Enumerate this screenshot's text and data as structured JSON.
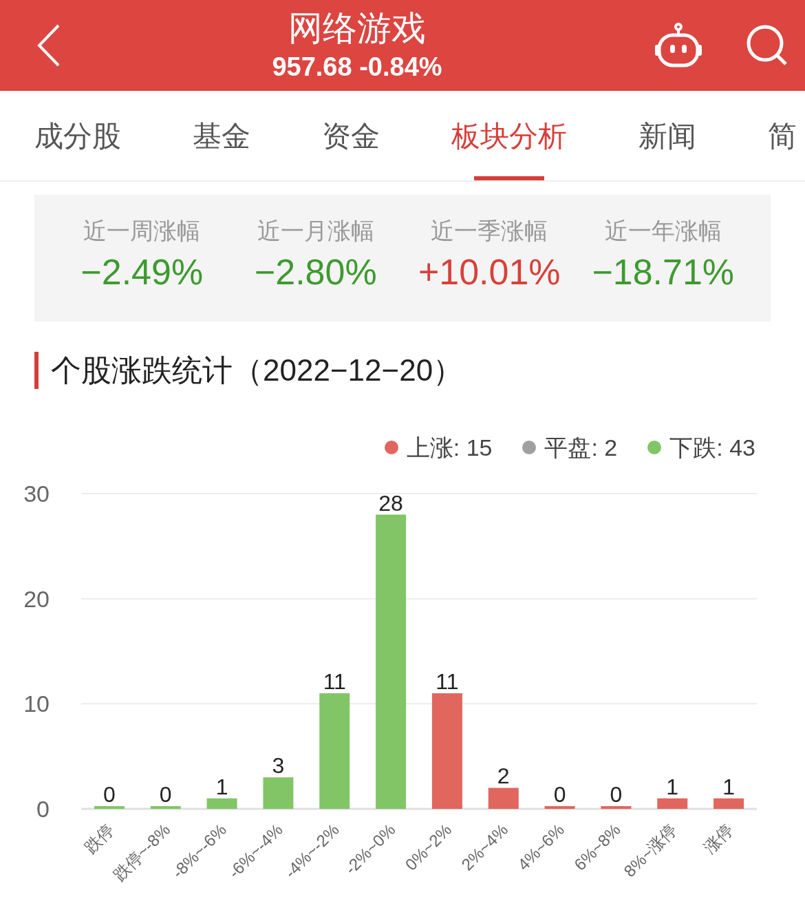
{
  "header": {
    "title": "网络游戏",
    "quote": "957.68 -0.84%"
  },
  "tabs": [
    {
      "label": "成分股",
      "selected": false
    },
    {
      "label": "基金",
      "selected": false
    },
    {
      "label": "资金",
      "selected": false
    },
    {
      "label": "板块分析",
      "selected": true
    },
    {
      "label": "新闻",
      "selected": false
    },
    {
      "label": "简",
      "selected": false
    }
  ],
  "performance": [
    {
      "label": "近一周涨幅",
      "value": "−2.49%",
      "color": "#3d9a2f"
    },
    {
      "label": "近一月涨幅",
      "value": "−2.80%",
      "color": "#3d9a2f"
    },
    {
      "label": "近一季涨幅",
      "value": "+10.01%",
      "color": "#d93f3a"
    },
    {
      "label": "近一年涨幅",
      "value": "−18.71%",
      "color": "#3d9a2f"
    }
  ],
  "section_title": "个股涨跌统计（2022−12−20）",
  "legend": [
    {
      "label": "上涨: 15",
      "color": "#e0665e"
    },
    {
      "label": "平盘: 2",
      "color": "#a0a0a0"
    },
    {
      "label": "下跌: 43",
      "color": "#82c566"
    }
  ],
  "chart_data": {
    "type": "bar",
    "categories": [
      "跌停",
      "跌停~-8%",
      "-8%~-6%",
      "-6%~-4%",
      "-4%~-2%",
      "-2%~0%",
      "0%~2%",
      "2%~4%",
      "4%~6%",
      "6%~8%",
      "8%~涨停",
      "涨停"
    ],
    "series": [
      {
        "color": "#82c566",
        "values": [
          0,
          0,
          1,
          3,
          11,
          28,
          null,
          null,
          null,
          null,
          null,
          null
        ]
      },
      {
        "color": "#e0665e",
        "values": [
          null,
          null,
          null,
          null,
          null,
          null,
          11,
          2,
          0,
          0,
          1,
          1
        ]
      }
    ],
    "ylim": [
      0,
      30
    ],
    "yticks": [
      0,
      10,
      20,
      30
    ],
    "data_labels": true
  }
}
